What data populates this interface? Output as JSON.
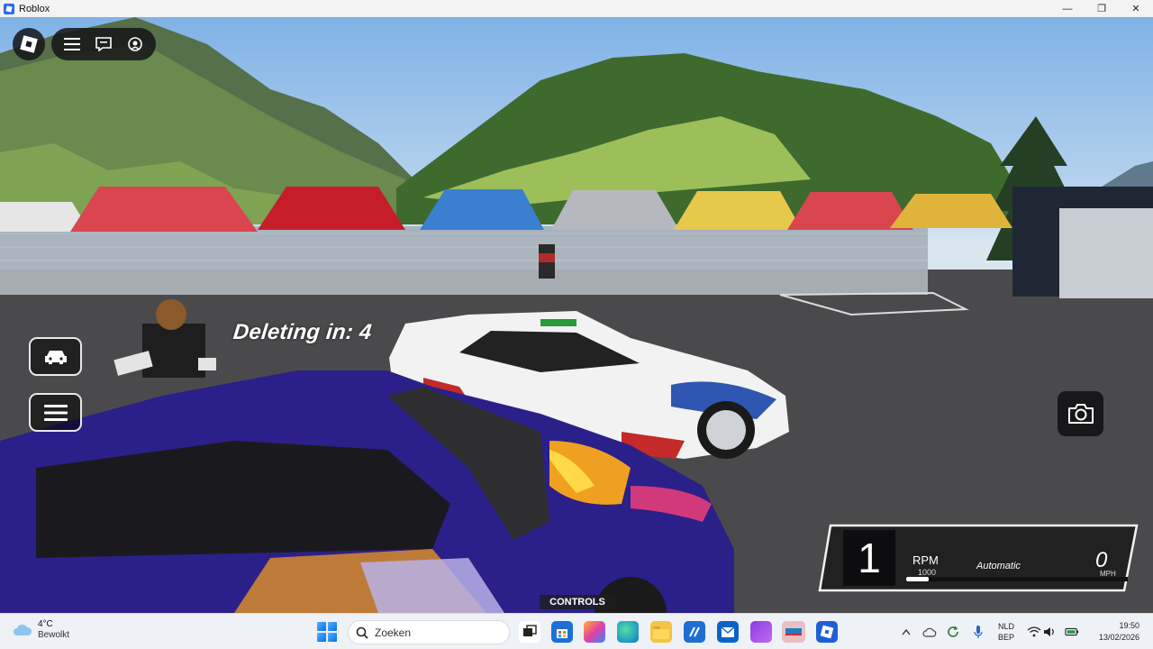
{
  "window": {
    "title": "Roblox",
    "minimize_glyph": "—",
    "maximize_glyph": "❐",
    "close_glyph": "✕"
  },
  "roblox_menu": {
    "icons": [
      "roblox-logo-icon",
      "hamburger-menu-icon",
      "chat-icon",
      "voice-icon"
    ]
  },
  "game": {
    "deleting_text": "Deleting in: 4",
    "controls_label": "CONTROLS",
    "side_buttons": [
      "car-icon",
      "menu-icon"
    ],
    "camera_button": "camera-icon"
  },
  "hud": {
    "gear": "1",
    "rpm_label": "RPM",
    "rpm_value": "1000",
    "rpm_fill_fraction": 0.1,
    "transmission": "Automatic",
    "speed": "0",
    "speed_unit": "MPH"
  },
  "taskbar": {
    "weather": {
      "temp": "4°C",
      "condition": "Bewolkt"
    },
    "search_placeholder": "Zoeken",
    "apps": [
      "task-view-icon",
      "store-icon",
      "copilot-icon",
      "edge-icon",
      "file-explorer-icon",
      "vscode-icon",
      "outlook-icon",
      "app-purple-icon",
      "app-active-icon",
      "roblox-app-icon"
    ],
    "language": {
      "line1": "NLD",
      "line2": "BEP"
    },
    "clock": {
      "time": "19:50",
      "date": "13/02/2026"
    }
  },
  "colors": {
    "taskbar_bg": "#eef1f6",
    "hud_bg": "#0d0d0f",
    "roblox_blue": "#2b6ce6"
  }
}
